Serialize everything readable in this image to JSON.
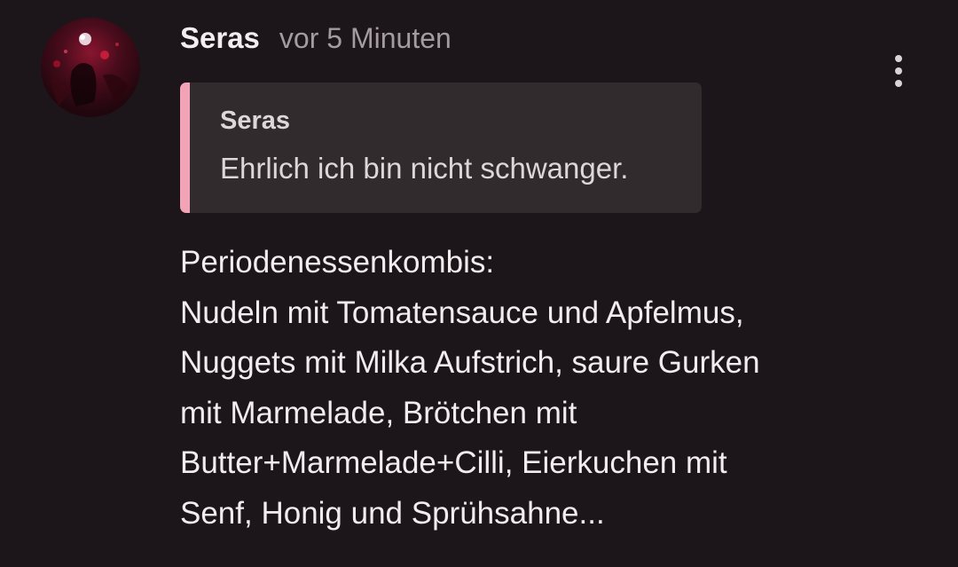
{
  "comment": {
    "author": "Seras",
    "timestamp": "vor 5 Minuten",
    "more_icon": "more-vertical-icon",
    "quote": {
      "author": "Seras",
      "text": "Ehrlich ich bin nicht schwanger.",
      "accent_color": "#f2a4b6"
    },
    "body_lines": [
      "Periodenessenkombis:",
      "Nudeln mit Tomatensauce und Apfelmus,",
      "Nuggets mit Milka Aufstrich, saure Gurken",
      "mit Marmelade, Brötchen mit",
      "Butter+Marmelade+Cilli, Eierkuchen mit",
      "Senf, Honig und Sprühsahne..."
    ]
  },
  "colors": {
    "background": "#1c1519",
    "quote_background": "#322b2d"
  }
}
